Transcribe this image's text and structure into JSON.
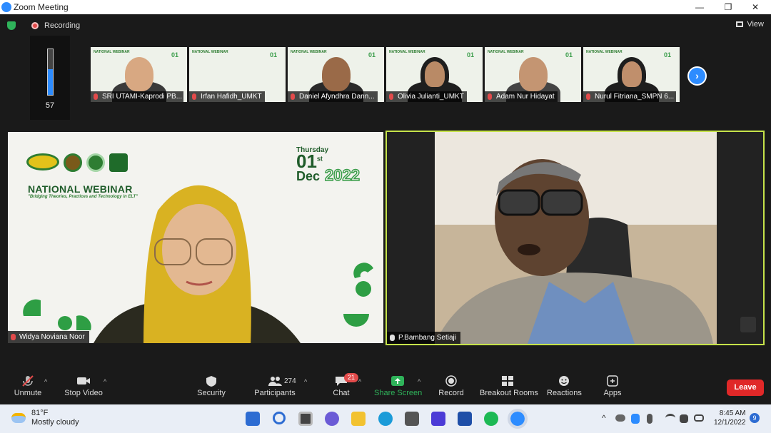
{
  "window": {
    "title": "Zoom Meeting",
    "minimize": "—",
    "restore": "❐",
    "close": "✕"
  },
  "status": {
    "recording": "Recording",
    "view": "View"
  },
  "volume": {
    "level": 57,
    "label": "57"
  },
  "thumbnails": [
    {
      "name": "SRI UTAMI-Kaprodi PB...",
      "mic": "muted"
    },
    {
      "name": "Irfan Hafidh_UMKT",
      "mic": "muted"
    },
    {
      "name": "Daniel Afyndhra Dann...",
      "mic": "muted"
    },
    {
      "name": "Olivia Julianti_UMKT",
      "mic": "muted"
    },
    {
      "name": "Adam Nur Hidayat",
      "mic": "muted"
    },
    {
      "name": "Nurul Fitriana_SMPN 6...",
      "mic": "muted"
    }
  ],
  "thumb_banner": {
    "title": "NATIONAL WEBINAR",
    "day": "01"
  },
  "next_label": "›",
  "main_left": {
    "name": "Widya Noviana Noor",
    "banner_title": "NATIONAL WEBINAR",
    "banner_subtitle": "\"Bridging Theories, Practices and Technology in ELT\"",
    "weekday": "Thursday",
    "day": "01",
    "day_suffix": "st",
    "month": "Dec",
    "year": "2022"
  },
  "main_right": {
    "name": "P.Bambang Setiaji"
  },
  "toolbar": {
    "unmute": "Unmute",
    "stop_video": "Stop Video",
    "security": "Security",
    "participants": "Participants",
    "participant_count": "274",
    "chat": "Chat",
    "chat_badge": "21",
    "share_screen": "Share Screen",
    "record": "Record",
    "breakout": "Breakout Rooms",
    "reactions": "Reactions",
    "apps": "Apps",
    "leave": "Leave",
    "caret": "^"
  },
  "taskbar": {
    "temp": "81°F",
    "weather": "Mostly cloudy",
    "time": "8:45 AM",
    "date": "12/1/2022",
    "notifications": "9",
    "tray_chevron": "^"
  },
  "colors": {
    "accent": "#2d8cff",
    "leave": "#e02828",
    "active_border": "#c6e34a",
    "share": "#2fb35a"
  }
}
